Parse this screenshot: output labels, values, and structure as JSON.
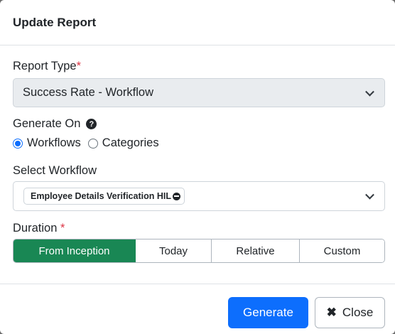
{
  "header": {
    "title": "Update Report"
  },
  "report_type": {
    "label": "Report Type",
    "required_mark": "*",
    "selected": "Success Rate - Workflow",
    "icon": "chevron-down-icon"
  },
  "generate_on": {
    "label": "Generate On",
    "help_icon": "question-circle-icon",
    "help_glyph": "?",
    "options": [
      {
        "label": "Workflows",
        "checked": true
      },
      {
        "label": "Categories",
        "checked": false
      }
    ]
  },
  "select_workflow": {
    "label": "Select Workflow",
    "chips": [
      {
        "label": "Employee Details Verification HIL",
        "remove_icon": "minus-circle-icon"
      }
    ],
    "icon": "chevron-down-icon"
  },
  "duration": {
    "label": "Duration",
    "required_mark": "*",
    "options": [
      {
        "label": "From Inception",
        "active": true
      },
      {
        "label": "Today",
        "active": false
      },
      {
        "label": "Relative",
        "active": false
      },
      {
        "label": "Custom",
        "active": false
      }
    ]
  },
  "footer": {
    "generate_label": "Generate",
    "close_label": "Close",
    "close_icon_glyph": "✖"
  },
  "colors": {
    "primary": "#0d6efd",
    "success": "#198754",
    "required": "#dc3545"
  }
}
